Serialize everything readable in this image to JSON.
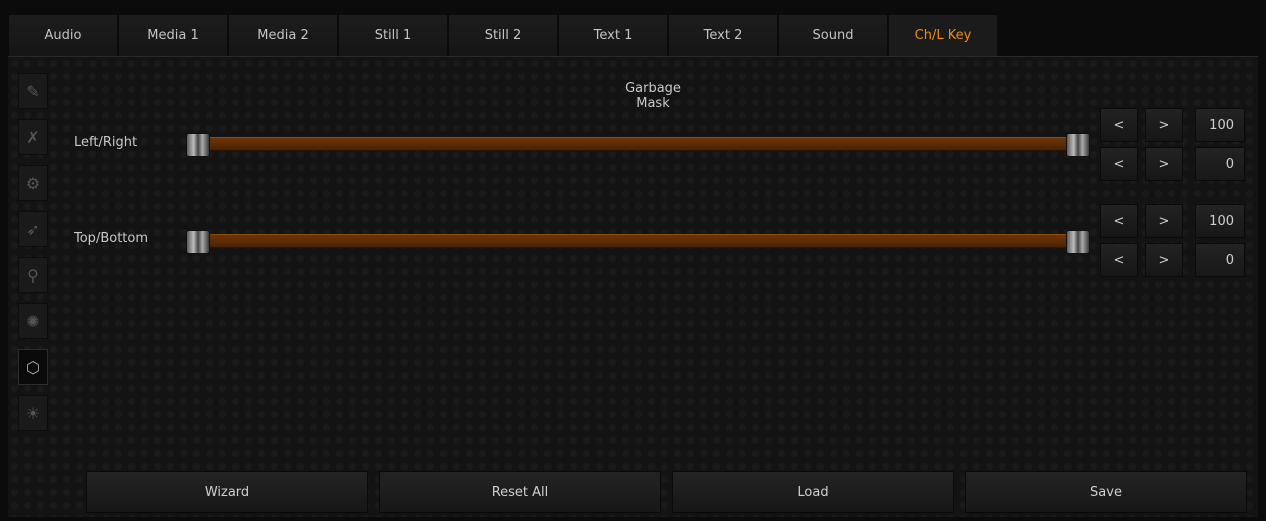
{
  "tabs": [
    {
      "label": "Audio"
    },
    {
      "label": "Media 1"
    },
    {
      "label": "Media 2"
    },
    {
      "label": "Still 1"
    },
    {
      "label": "Still 2"
    },
    {
      "label": "Text 1"
    },
    {
      "label": "Text 2"
    },
    {
      "label": "Sound"
    },
    {
      "label": "Ch/L Key",
      "active": true
    }
  ],
  "accent_color": "#ef8a12",
  "side_icons": [
    "wand-icon",
    "wand-off-icon",
    "gear-wand-icon",
    "brush-icon",
    "eyedropper-icon",
    "color-sample-icon",
    "garbage-mask-icon",
    "sun-wand-icon"
  ],
  "active_side_icon": "garbage-mask-icon",
  "section_title": "Garbage Mask",
  "rows": [
    {
      "label": "Left/Right",
      "max": "100",
      "min": "0"
    },
    {
      "label": "Top/Bottom",
      "max": "100",
      "min": "0"
    }
  ],
  "stepper": {
    "dec": "<",
    "inc": ">"
  },
  "bottom_buttons": {
    "wizard": "Wizard",
    "reset_all": "Reset All",
    "load": "Load",
    "save": "Save"
  }
}
